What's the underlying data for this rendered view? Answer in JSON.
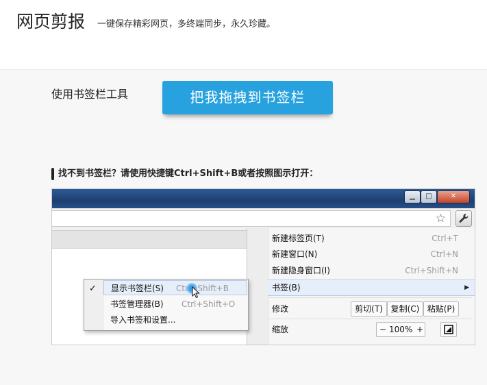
{
  "header": {
    "title": "网页剪报",
    "slogan": "一键保存精彩网页，多终端同步，永久珍藏。"
  },
  "tool": {
    "label": "使用书签栏工具",
    "bookmarklet_button": "把我拖拽到书签栏"
  },
  "hint": "找不到书签栏？请使用快捷键Ctrl+Shift+B或者按照图示打开：",
  "browser": {
    "window_buttons": {
      "minimize": "▁",
      "maximize": "□",
      "close": "✕"
    },
    "menu": {
      "items": [
        {
          "label": "新建标签页(T)",
          "shortcut": "Ctrl+T"
        },
        {
          "label": "新建窗口(N)",
          "shortcut": "Ctrl+N"
        },
        {
          "label": "新建隐身窗口(I)",
          "shortcut": "Ctrl+Shift+N"
        }
      ],
      "bookmarks": {
        "label": "书签(B)",
        "arrow": "▶"
      },
      "edit": {
        "label": "修改",
        "cut": "剪切(T)",
        "copy": "复制(C)",
        "paste": "粘贴(P)"
      },
      "zoom": {
        "label": "缩放",
        "minus": "−",
        "value": "100%",
        "plus": "+"
      }
    },
    "submenu": {
      "check": "✓",
      "items": [
        {
          "label": "显示书签栏(S)",
          "shortcut": "Ctrl+Shift+B"
        },
        {
          "label": "书签管理器(B)",
          "shortcut": "Ctrl+Shift+O"
        },
        {
          "label": "导入书签和设置..."
        }
      ]
    }
  },
  "colors": {
    "accent_button": "#27a2df",
    "titlebar": "#1d3f72",
    "menu_highlight": "#e6eefa"
  },
  "icons": [
    "star-icon",
    "wrench-icon",
    "check-icon",
    "cursor-icon",
    "fullscreen-icon",
    "submenu-arrow-icon"
  ]
}
